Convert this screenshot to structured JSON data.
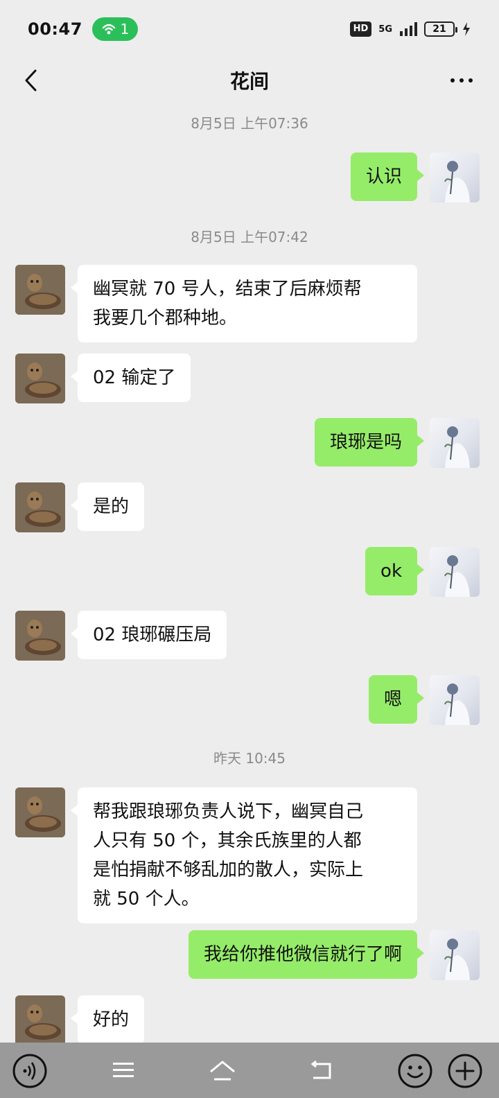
{
  "status_bar": {
    "time": "00:47",
    "hotspot_count": "1",
    "hd_label": "HD",
    "network_label": "5G",
    "battery_level": "21"
  },
  "header": {
    "title": "花间"
  },
  "messages": [
    {
      "type": "timestamp",
      "text": "8月5日 上午07:36"
    },
    {
      "type": "out",
      "text": "认识"
    },
    {
      "type": "timestamp",
      "text": "8月5日 上午07:42"
    },
    {
      "type": "in",
      "lines": [
        "幽冥就 70 号人，结束了后麻烦帮",
        "我要几个郡种地。"
      ]
    },
    {
      "type": "in",
      "text": "02 输定了"
    },
    {
      "type": "out",
      "text": "琅琊是吗"
    },
    {
      "type": "in",
      "text": "是的"
    },
    {
      "type": "out",
      "text": "ok"
    },
    {
      "type": "in",
      "text": "02 琅琊碾压局"
    },
    {
      "type": "out",
      "text": "嗯"
    },
    {
      "type": "timestamp",
      "text": "昨天 10:45"
    },
    {
      "type": "in",
      "lines": [
        "帮我跟琅琊负责人说下，幽冥自己",
        "人只有 50 个，其余氏族里的人都",
        "是怕捐献不够乱加的散人，实际上",
        "就 50 个人。"
      ]
    },
    {
      "type": "out",
      "text": "我给你推他微信就行了啊"
    },
    {
      "type": "in",
      "text": "好的"
    }
  ],
  "colors": {
    "background": "#ededed",
    "outgoing_bubble": "#95ec69",
    "incoming_bubble": "#ffffff",
    "hotspot_pill": "#2bbf5a",
    "bottom_bar": "#9a9a9a"
  },
  "icons": {
    "back": "chevron-left-icon",
    "more": "more-dots-icon",
    "voice": "voice-icon",
    "menu": "menu-icon",
    "home": "home-icon",
    "nav_back": "back-arrow-icon",
    "emoji": "emoji-icon",
    "plus": "plus-icon"
  }
}
